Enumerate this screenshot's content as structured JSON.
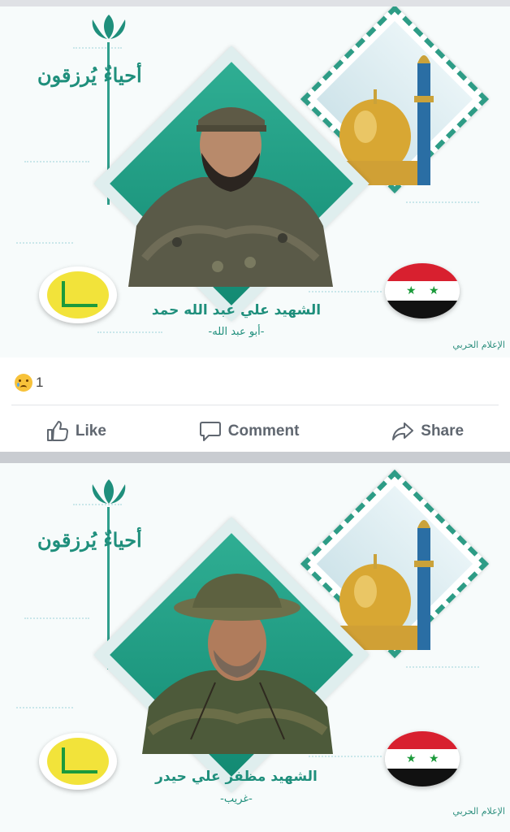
{
  "posts": [
    {
      "slogan": "أحياءٌ يُرزقون",
      "martyr_name": "الشهيد علي عبد الله حمد",
      "nickname": "-أبو عبد الله-",
      "credit": "الإعلام الحربي",
      "reaction_count": "1"
    },
    {
      "slogan": "أحياءٌ يُرزقون",
      "martyr_name": "الشهيد مظفر علي حيدر",
      "nickname": "-غريب-",
      "credit": "الإعلام الحربي"
    }
  ],
  "actions": {
    "like": "Like",
    "comment": "Comment",
    "share": "Share"
  },
  "colors": {
    "accent": "#1f8f7c",
    "action_text": "#606770"
  },
  "icons": [
    "tulip-logo-icon",
    "hezbollah-logo-icon",
    "syrian-flag-icon",
    "sad-reaction-icon",
    "like-icon",
    "comment-icon",
    "share-icon"
  ]
}
